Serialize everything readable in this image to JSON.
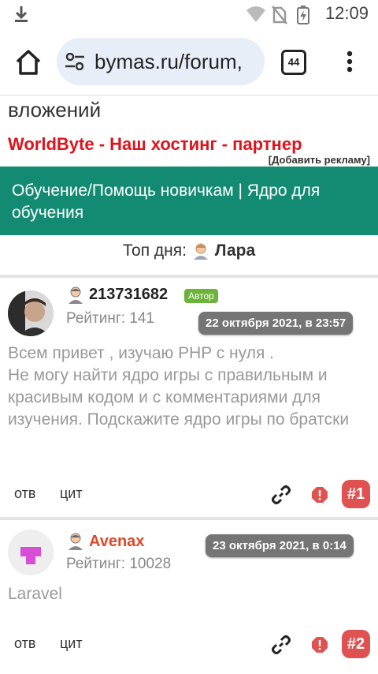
{
  "status": {
    "time": "12:09"
  },
  "browser": {
    "url": "bymas.ru/forum,",
    "tab_count": "44"
  },
  "page": {
    "header_tail": "вложений",
    "ad_text": "WorldByte - Наш хостинг - партнер",
    "add_ad_label": "[Добавить рекламу]",
    "topic_title": "Обучение/Помощь новичкам | Ядро для обучения",
    "top_day_label": "Топ дня:",
    "top_day_user": "Лара"
  },
  "posts": [
    {
      "username": "213731682",
      "author_tag": "Автор",
      "rating": "Рейтинг: 141",
      "date": "22 октября 2021, в 23:57",
      "text": "Всем привет , изучаю PHP с нуля .\nНе могу найти ядро игры с правильным и красивым кодом и с комментариями для изучения. Подскажите ядро игры по братски",
      "reply_label": "отв",
      "quote_label": "цит",
      "number": "#1"
    },
    {
      "username": "Avenax",
      "rating": "Рейтинг: 10028",
      "date": "23 октября 2021, в 0:14",
      "text": "Laravel",
      "reply_label": "отв",
      "quote_label": "цит",
      "number": "#2"
    }
  ],
  "colors": {
    "banner": "#138a72",
    "ad_red": "#e0121c",
    "author_green": "#6bb33a",
    "post_number": "#e05252",
    "username_red": "#e0472a"
  }
}
